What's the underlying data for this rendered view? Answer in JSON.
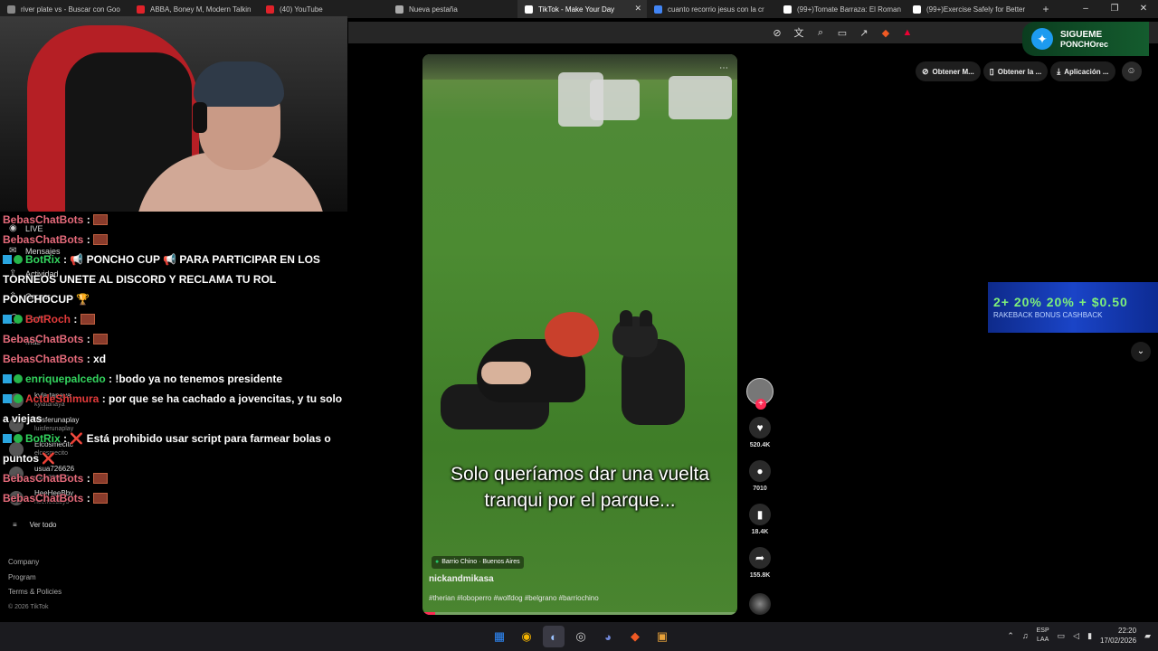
{
  "browser": {
    "tabs": [
      {
        "label": "river plate vs - Buscar con Goo",
        "color": "#888888",
        "active": false
      },
      {
        "label": "ABBA, Boney M, Modern Talkin",
        "color": "#e0222a",
        "active": false
      },
      {
        "label": "(40) YouTube",
        "color": "#e0222a",
        "active": false
      },
      {
        "label": "Nueva pestaña",
        "color": "#aaaaaa",
        "active": false
      },
      {
        "label": "TikTok - Make Your Day",
        "color": "#ffffff",
        "active": true
      },
      {
        "label": "cuanto recorrio jesus con la cr",
        "color": "#4285f4",
        "active": false
      },
      {
        "label": "(99+)Tomate Barraza: El Roman",
        "color": "#ffffff",
        "active": false
      },
      {
        "label": "(99+)Exercise Safely for Better",
        "color": "#ffffff",
        "active": false
      }
    ],
    "new_tab": "+",
    "close_glyph": "✕"
  },
  "overlay": {
    "twitter_line1": "SIGUEME",
    "twitter_line2": "PONCHOrec"
  },
  "sidebar": {
    "nav": [
      {
        "icon": "◉",
        "label": "LIVE"
      },
      {
        "icon": "✉",
        "label": "Mensajes"
      },
      {
        "icon": "⇪",
        "label": "Actividad"
      },
      {
        "icon": "⇧",
        "label": "Cargar"
      },
      {
        "icon": "◯",
        "label": "Perfil"
      },
      {
        "icon": "⋯",
        "label": "Más"
      }
    ],
    "following": [
      {
        "name": "kyla tanaya",
        "handle": "kylatanaya"
      },
      {
        "name": "luisferunaplay",
        "handle": "luisferunaplay"
      },
      {
        "name": "Elcosmecito",
        "handle": "elcosmecito"
      },
      {
        "name": "usua726626",
        "handle": "usua726626"
      },
      {
        "name": "HeeHeeBby",
        "handle": "heeheebby0"
      }
    ],
    "see_all": "Ver todo",
    "footer": [
      "Company",
      "Program",
      "Terms & Policies"
    ],
    "copyright": "© 2026 TikTok"
  },
  "chat": [
    {
      "user": "BebasChatBots",
      "cls": "user-bots",
      "text": "",
      "emote": true
    },
    {
      "user": "BebasChatBots",
      "cls": "user-bots",
      "text": "",
      "emote": true
    },
    {
      "user": "BotRix",
      "cls": "user-botrix",
      "text": "📢 PONCHO CUP 📢 PARA PARTICIPAR EN LOS TORNEOS UNETE AL DISCORD Y RECLAMA TU ROL PONCHOCUP 🏆",
      "emote": false
    },
    {
      "user": "BotRoch",
      "cls": "user-mod",
      "text": "",
      "emote": true
    },
    {
      "user": "BebasChatBots",
      "cls": "user-bots",
      "text": "",
      "emote": true
    },
    {
      "user": "BebasChatBots",
      "cls": "user-bots",
      "text": "xd",
      "emote": false
    },
    {
      "user": "enriquepalcedo",
      "cls": "user-enrique",
      "text": "!bodo ya no tenemos presidente",
      "emote": false
    },
    {
      "user": "ActdeShimura",
      "cls": "user-mod",
      "text": "por que se ha cachado a jovencitas, y tu solo a viejas",
      "emote": false
    },
    {
      "user": "BotRix",
      "cls": "user-botrix",
      "text": "❌ Está prohibido usar script para farmear bolas o puntos ❌",
      "emote": false
    },
    {
      "user": "BebasChatBots",
      "cls": "user-bots",
      "text": "",
      "emote": true
    },
    {
      "user": "BebasChatBots",
      "cls": "user-bots",
      "text": "",
      "emote": true
    }
  ],
  "video": {
    "caption": "Solo queríamos dar una vuelta tranqui por el parque...",
    "location": "Barrio Chino · Buenos Aires",
    "author": "nickandmikasa",
    "hashtags": "#therian #loboperro #wolfdog #belgrano #barriochino",
    "more": "⋯",
    "progress": 0.04
  },
  "actions": {
    "likes": "520.4K",
    "comments": "7010",
    "saves": "18.4K",
    "shares": "155.8K"
  },
  "top_right": {
    "pill1": "Obtener M...",
    "pill2": "Obtener la ...",
    "pill3": "Aplicación ..."
  },
  "promo": {
    "line1": "2+ 20% 20% + $0.50",
    "line2": "RAKEBACK  BONUS  CASHBACK"
  },
  "taskbar": {
    "lang1": "ESP",
    "lang2": "LAA",
    "time": "22:20",
    "date": "17/02/2026"
  }
}
